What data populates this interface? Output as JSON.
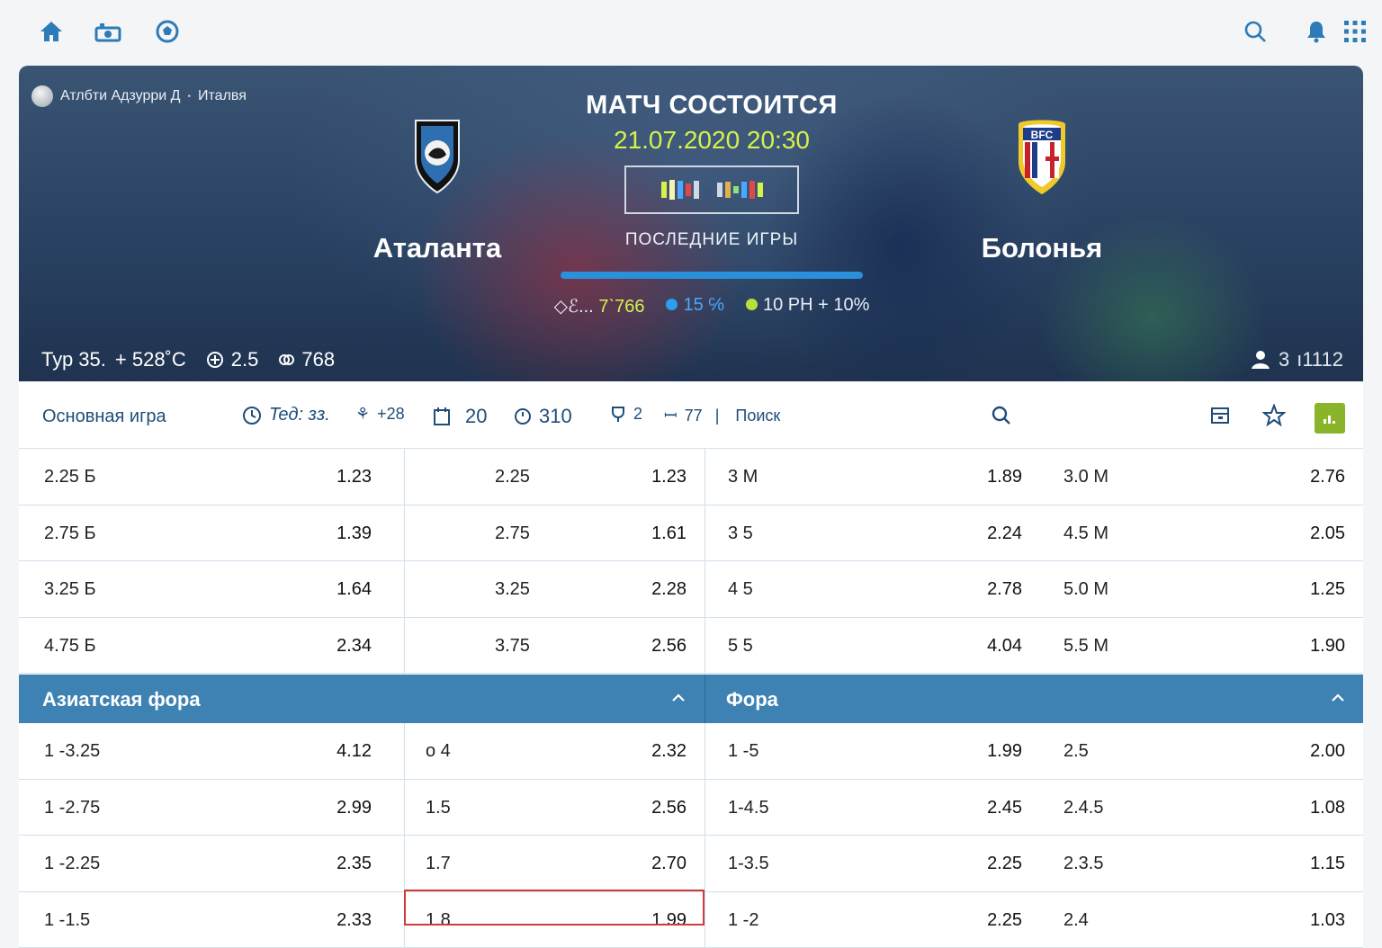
{
  "hero": {
    "breadcrumb_league": "Атлбти Адзурри Д",
    "breadcrumb_country": "Италвя",
    "status": "МАТЧ СОСТОИТСЯ",
    "datetime": "21.07.2020 20:30",
    "last_games_label": "ПОСЛЕДНИЕ ИГРЫ",
    "home_team": "Аталанта",
    "away_team": "Болонья",
    "stat_1": "◇ℰ...",
    "stat_1_value": "7ˋ766",
    "stat_2": "15 ℅",
    "stat_3": "10 РН + 10%",
    "round": "Тур 35.",
    "temperature": "+ 528˚C",
    "total": "2.5",
    "count": "768",
    "right_info_a": "3",
    "right_info_b": "ı1112",
    "form_colors": [
      "#d6f24a",
      "#f4f4b0",
      "#4aa9ff",
      "#e04848",
      "#cfd8e3",
      "#cfd8e3",
      "#e0b050",
      "#8ee07a",
      "#4aa9ff",
      "#e04848"
    ]
  },
  "filterbar": {
    "main_label": "Основная игра",
    "item_1": "Teд: зз.",
    "item_2": "+28",
    "item_3": "20",
    "item_4": "310",
    "item_5": "2",
    "item_6": "77",
    "separator": "|",
    "search_label": "Поиск"
  },
  "totals": [
    {
      "a": "2.25 Б",
      "a_odd": "1.23",
      "b": "2.25",
      "b_odd": "1.23",
      "c": "3 М",
      "c_odd": "1.89",
      "d": "3.0 М",
      "d_odd": "2.76"
    },
    {
      "a": "2.75 Б",
      "a_odd": "1.39",
      "b": "2.75",
      "b_odd": "1.61",
      "c": "3 5",
      "c_odd": "2.24",
      "d": "4.5 М",
      "d_odd": "2.05"
    },
    {
      "a": "3.25 Б",
      "a_odd": "1.64",
      "b": "3.25",
      "b_odd": "2.28",
      "c": "4 5",
      "c_odd": "2.78",
      "d": "5.0 М",
      "d_odd": "1.25"
    },
    {
      "a": "4.75 Б",
      "a_odd": "2.34",
      "b": "3.75",
      "b_odd": "2.56",
      "c": "5 5",
      "c_odd": "4.04",
      "d": "5.5 М",
      "d_odd": "1.90"
    }
  ],
  "sections": {
    "asian": "Азиатская фора",
    "handicap": "Фора"
  },
  "handicaps": [
    {
      "a": "1 -3.25",
      "a_odd": "4.12",
      "b": "о 4",
      "b_odd": "2.32",
      "c": "1 -5",
      "c_odd": "1.99",
      "d": "2.5",
      "d_odd": "2.00"
    },
    {
      "a": "1 -2.75",
      "a_odd": "2.99",
      "b": "1.5",
      "b_odd": "2.56",
      "c": "1-4.5",
      "c_odd": "2.45",
      "d": "2.4.5",
      "d_odd": "1.08"
    },
    {
      "a": "1 -2.25",
      "a_odd": "2.35",
      "b": "1.7",
      "b_odd": "2.70",
      "c": "1-3.5",
      "c_odd": "2.25",
      "d": "2.3.5",
      "d_odd": "1.15"
    },
    {
      "a": "1 -1.5",
      "a_odd": "2.33",
      "b": "1.8",
      "b_odd": "1.99",
      "c": "1 -2",
      "c_odd": "2.25",
      "d": "2.4",
      "d_odd": "1.03"
    }
  ]
}
